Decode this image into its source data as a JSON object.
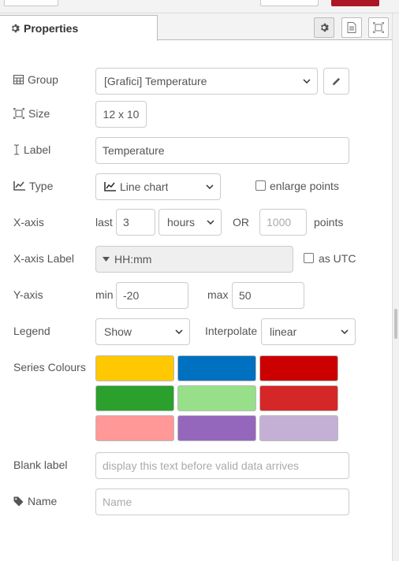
{
  "tab": {
    "label": "Properties"
  },
  "group": {
    "label": "Group",
    "value": "[Grafici] Temperature"
  },
  "size": {
    "label": "Size",
    "value": "12 x 10"
  },
  "label_field": {
    "label": "Label",
    "value": "Temperature"
  },
  "type": {
    "label": "Type",
    "value": "Line chart",
    "enlarge_label": "enlarge points"
  },
  "xaxis": {
    "label": "X-axis",
    "last_label": "last",
    "last_value": "3",
    "unit": "hours",
    "or_label": "OR",
    "points_placeholder": "1000",
    "points_label": "points"
  },
  "xaxis_label": {
    "label": "X-axis Label",
    "value": "HH:mm",
    "utc_label": "as UTC"
  },
  "yaxis": {
    "label": "Y-axis",
    "min_label": "min",
    "min_value": "-20",
    "max_label": "max",
    "max_value": "50"
  },
  "legend": {
    "label": "Legend",
    "value": "Show",
    "interpolate_label": "Interpolate",
    "interpolate_value": "linear"
  },
  "series": {
    "label": "Series Colours",
    "colors": [
      "#ffc800",
      "#0070c0",
      "#cc0000",
      "#2ca02c",
      "#98df8a",
      "#d62728",
      "#ff9896",
      "#9467bd",
      "#c5b0d5"
    ]
  },
  "blank_label": {
    "label": "Blank label",
    "placeholder": "display this text before valid data arrives"
  },
  "name": {
    "label": "Name",
    "placeholder": "Name"
  }
}
